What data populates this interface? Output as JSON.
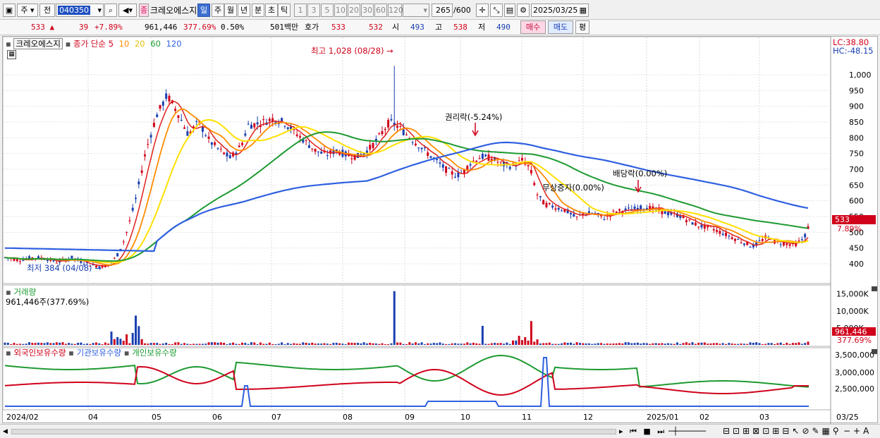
{
  "toolbar": {
    "type_label": "주",
    "prev_label": "전",
    "code_value": "040350",
    "sim_badge": "종",
    "stock_name": "크레오에스지",
    "periods": [
      "일",
      "주",
      "월",
      "년",
      "분",
      "초",
      "틱"
    ],
    "active_period": "일",
    "intervals": [
      "1",
      "3",
      "5",
      "10",
      "20",
      "30",
      "60",
      "120"
    ],
    "count_value": "265",
    "count_total": "/600",
    "date_value": "2025/03/25"
  },
  "quote": {
    "price": "533",
    "change": "39",
    "change_rate": "+7.89%",
    "volume": "961,446",
    "volume_ratio": "377.69%",
    "turnover_pct": "0.50%",
    "amount": "501백만",
    "bid_label": "호가",
    "ask_price": "533",
    "bid_price": "532",
    "open_label": "시",
    "open": "493",
    "high_label": "고",
    "high": "538",
    "low_label": "저",
    "low": "490",
    "buy_label": "매수",
    "sell_label": "매도",
    "flat_label": "평"
  },
  "chart": {
    "stock_title": "크레오에스지",
    "ma_label": "종가 단순",
    "ma_periods": [
      "5",
      "10",
      "20",
      "60",
      "120"
    ],
    "ma_colors": [
      "#e0201a",
      "#ff8c00",
      "#ffe000",
      "#1e9a32",
      "#2f60e0"
    ],
    "lc_label": "LC:38.80",
    "hc_label": "HC:-48.15",
    "high_note": "최고 1,028 (08/28)",
    "low_note": "최저 384 (04/08)",
    "event_rights": "권리락(-5.24%)",
    "event_bonus": "무상증자(0.00%)",
    "event_dividend": "배당락(0.00%)",
    "current_price": "533",
    "current_rate": "7.89%",
    "y_ticks": [
      "1,000",
      "950",
      "900",
      "850",
      "800",
      "750",
      "700",
      "650",
      "600",
      "550",
      "500",
      "450",
      "400"
    ],
    "volume_title": "거래량",
    "volume_value": "961,446주(377.69%)",
    "volume_ticks": [
      "15,000K",
      "10,000K",
      "5,000K"
    ],
    "volume_current": "961,446",
    "volume_current_pct": "377.69%",
    "holdings_titles": [
      "외국인보유수량",
      "기관보유수량",
      "개인보유수량"
    ],
    "holdings_ticks": [
      "3,500,000",
      "3,000,000",
      "2,500,000"
    ],
    "x_labels": [
      "2024/02",
      "04",
      "05",
      "06",
      "07",
      "08",
      "09",
      "10",
      "11",
      "12",
      "2025/01",
      "02",
      "03",
      "03/25"
    ]
  }
}
